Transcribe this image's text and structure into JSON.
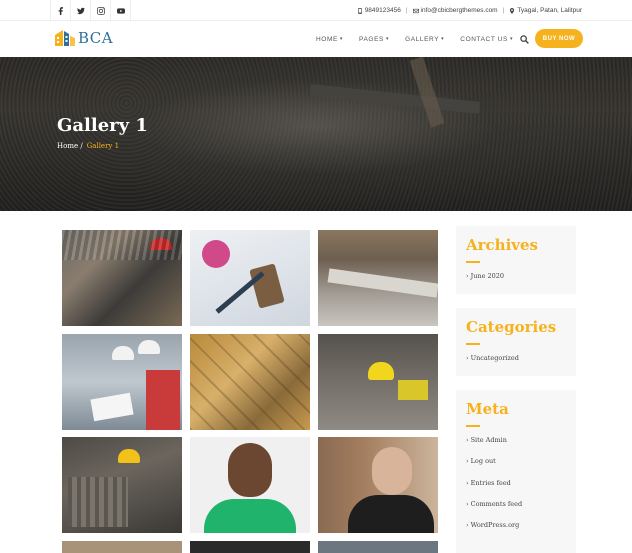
{
  "topbar": {
    "social": [
      {
        "name": "facebook"
      },
      {
        "name": "twitter"
      },
      {
        "name": "instagram"
      },
      {
        "name": "youtube"
      }
    ],
    "phone": "9849123456",
    "email": "info@cbicbergthemes.com",
    "address": "Tyagal, Patan, Lalitpur"
  },
  "header": {
    "logo_text": "BCA",
    "nav": [
      {
        "label": "HOME"
      },
      {
        "label": "PAGES"
      },
      {
        "label": "GALLERY"
      },
      {
        "label": "CONTACT US"
      }
    ],
    "buy_label": "BUY NOW"
  },
  "banner": {
    "title": "Gallery 1",
    "breadcrumb_home": "Home /",
    "breadcrumb_current": "Gallery 1"
  },
  "sidebar": {
    "archives": {
      "title": "Archives",
      "items": [
        "June 2020"
      ]
    },
    "categories": {
      "title": "Categories",
      "items": [
        "Uncategorized"
      ]
    },
    "meta": {
      "title": "Meta",
      "items": [
        "Site Admin",
        "Log out",
        "Entries feed",
        "Comments feed",
        "WordPress.org"
      ]
    }
  },
  "colors": {
    "accent": "#f6b21c",
    "logo_blue": "#2f6f9a"
  }
}
